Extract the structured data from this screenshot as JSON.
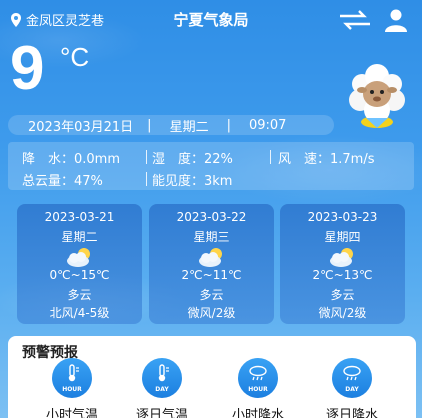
{
  "header": {
    "location": "金凤区灵芝巷",
    "title": "宁夏气象局"
  },
  "current": {
    "temperature": "9",
    "unit": "°C",
    "date": "2023年03月21日",
    "weekday": "星期二",
    "time": "09:07"
  },
  "stats": {
    "precip": "降　水：0.0mm",
    "humidity": "湿　度：22%",
    "wind_speed": "风　速：1.7m/s",
    "cloud": "总云量：47%",
    "visibility": "能见度：3km"
  },
  "forecast": [
    {
      "date": "2023-03-21",
      "weekday": "星期二",
      "temp": "0℃~15℃",
      "weather": "多云",
      "wind": "北风/4-5级",
      "icon": "partly-cloudy-icon"
    },
    {
      "date": "2023-03-22",
      "weekday": "星期三",
      "temp": "2℃~11℃",
      "weather": "多云",
      "wind": "微风/2级",
      "icon": "partly-cloudy-icon"
    },
    {
      "date": "2023-03-23",
      "weekday": "星期四",
      "temp": "2℃~13℃",
      "weather": "多云",
      "wind": "微风/2级",
      "icon": "partly-cloudy-icon"
    }
  ],
  "alerts": {
    "title": "预警预报",
    "buttons": [
      {
        "tag": "HOUR",
        "label": "小时气温",
        "icon": "thermometer-icon"
      },
      {
        "tag": "DAY",
        "label": "逐日气温",
        "icon": "thermometer-icon"
      },
      {
        "tag": "HOUR",
        "label": "小时降水",
        "icon": "rain-cloud-icon"
      },
      {
        "tag": "DAY",
        "label": "逐日降水",
        "icon": "rain-cloud-icon"
      }
    ]
  },
  "colors": {
    "background": "#3e9bec",
    "card": "#2e78cc",
    "accent_button": "#1c7fe0"
  }
}
